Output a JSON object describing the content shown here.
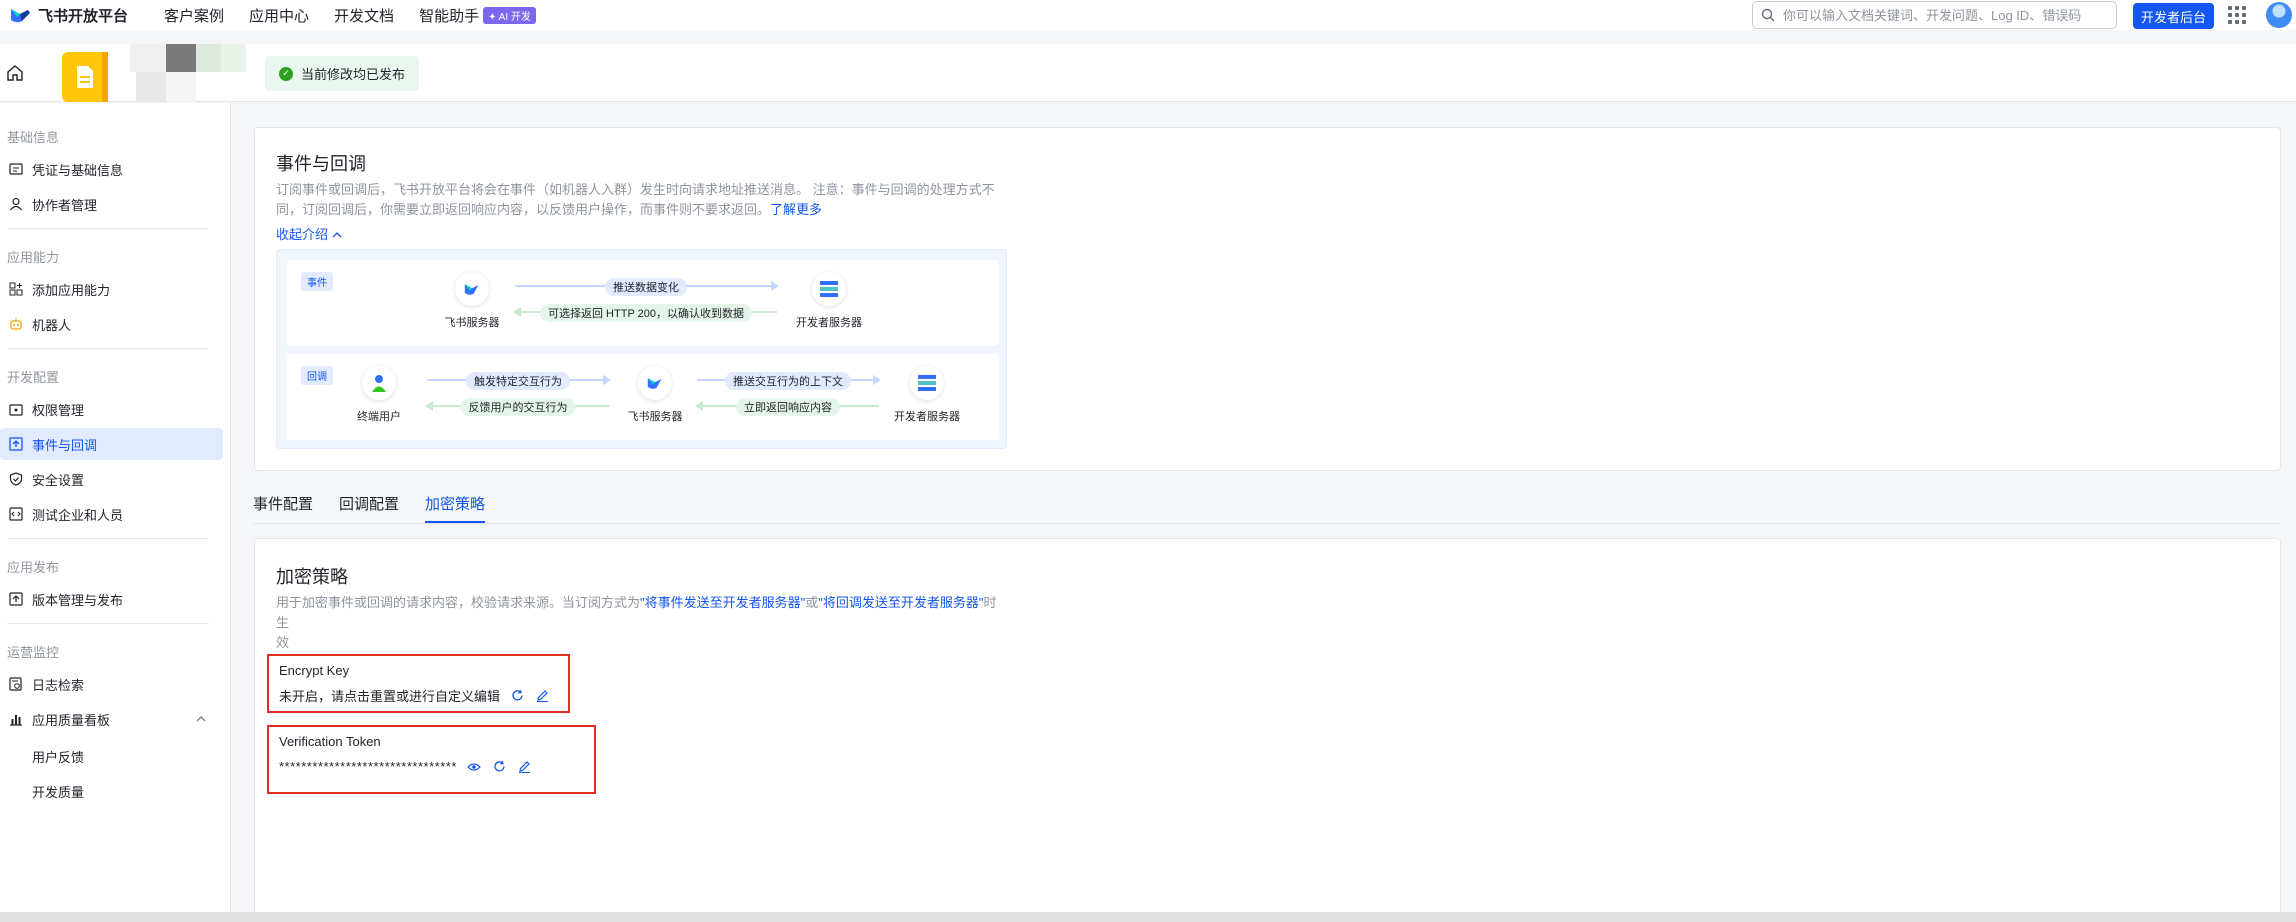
{
  "topbar": {
    "logo_text": "飞书开放平台",
    "nav": [
      "客户案例",
      "应用中心",
      "开发文档",
      "智能助手"
    ],
    "ai_badge": "✦ AI 开发",
    "search_placeholder": "你可以输入文档关键词、开发问题、Log ID、错误码",
    "dev_console": "开发者后台"
  },
  "appbar": {
    "published": "当前修改均已发布"
  },
  "sidebar": {
    "groups": [
      {
        "title": "基础信息",
        "items": [
          "凭证与基础信息",
          "协作者管理"
        ]
      },
      {
        "title": "应用能力",
        "items": [
          "添加应用能力",
          "机器人"
        ]
      },
      {
        "title": "开发配置",
        "items": [
          "权限管理",
          "事件与回调",
          "安全设置",
          "测试企业和人员"
        ]
      },
      {
        "title": "应用发布",
        "items": [
          "版本管理与发布"
        ]
      },
      {
        "title": "运营监控",
        "items": [
          "日志检索",
          "应用质量看板"
        ],
        "sub": [
          "用户反馈",
          "开发质量"
        ]
      }
    ],
    "active": "事件与回调"
  },
  "intro": {
    "title": "事件与回调",
    "desc_line1": "订阅事件或回调后，飞书开放平台将会在事件（如机器人入群）发生时向请求地址推送消息。 注意：事件与回调的处理方式不",
    "desc_line2": "同，订阅回调后，你需要立即返回响应内容，以反馈用户操作，而事件则不要求返回。",
    "learn_more": "了解更多",
    "collapse": "收起介绍",
    "diagram": {
      "event_tag": "事件",
      "callback_tag": "回调",
      "feishu_server": "飞书服务器",
      "dev_server": "开发者服务器",
      "end_user": "终端用户",
      "push_data": "推送数据变化",
      "optional_return": "可选择返回 HTTP 200，以确认收到数据",
      "trigger": "触发特定交互行为",
      "feedback": "反馈用户的交互行为",
      "push_context": "推送交互行为的上下文",
      "immediate_return": "立即返回响应内容"
    }
  },
  "tabs": [
    "事件配置",
    "回调配置",
    "加密策略"
  ],
  "active_tab": "加密策略",
  "encrypt": {
    "title": "加密策略",
    "desc_a": "用于加密事件或回调的请求内容，校验请求来源。当订阅方式为",
    "desc_link1": "\"将事件发送至开发者服务器\"",
    "desc_b": "或",
    "desc_link2": "\"将回调发送至开发者服务器\"",
    "desc_c": "时生",
    "desc_d": "效",
    "encrypt_key_label": "Encrypt Key",
    "encrypt_key_value": "未开启，请点击重置或进行自定义编辑",
    "token_label": "Verification Token",
    "token_value": "********************************"
  },
  "colors": {
    "accent": "#1456f0",
    "highlight_border": "#e02d20",
    "success": "#2ea121"
  }
}
